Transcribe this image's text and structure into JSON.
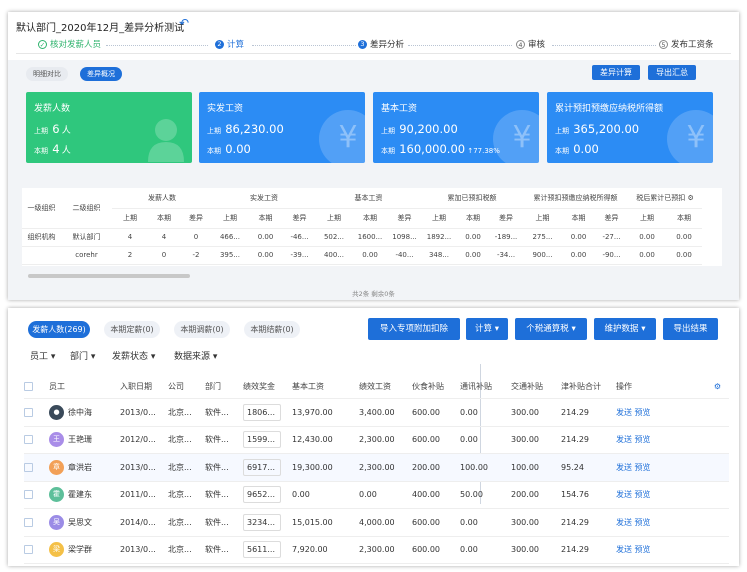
{
  "header": {
    "title": "默认部门_2020年12月_差异分析测试"
  },
  "steps": [
    {
      "label": "核对发薪人员",
      "index": "✓",
      "state": "done"
    },
    {
      "label": "计算",
      "index": "2",
      "state": "done"
    },
    {
      "label": "差异分析",
      "index": "3",
      "state": "active"
    },
    {
      "label": "审核",
      "index": "4",
      "state": "todo"
    },
    {
      "label": "发布工资条",
      "index": "5",
      "state": "todo"
    }
  ],
  "view_tabs": {
    "detail": "明细对比",
    "summary": "差异概况"
  },
  "buttons": {
    "diff_calc": "差异计算",
    "export_summary": "导出汇总"
  },
  "labels": {
    "prev": "上期",
    "curr": "本期"
  },
  "cards": [
    {
      "title": "发薪人数",
      "prev": "6",
      "prev_unit": "人",
      "curr": "4",
      "curr_unit": "人",
      "color": "#2fc77d",
      "icon": "person-icon"
    },
    {
      "title": "实发工资",
      "prev": "86,230.00",
      "curr": "0.00",
      "color": "#2c8cf4",
      "icon": "yen-icon"
    },
    {
      "title": "基本工资",
      "prev": "90,200.00",
      "curr": "160,000.00",
      "change": "↑77.38%",
      "color": "#2c8cf4",
      "icon": "yen-icon"
    },
    {
      "title": "累计预扣预缴应纳税所得额",
      "prev": "365,200.00",
      "curr": "0.00",
      "color": "#2c8cf4",
      "icon": "yen-icon"
    }
  ],
  "diff_table": {
    "col1": "一级组织",
    "col2": "二级组织",
    "groups": [
      "发薪人数",
      "实发工资",
      "基本工资",
      "累加已预扣税额",
      "累计预扣预缴应纳税所得额",
      "税后累计已预扣"
    ],
    "sub": [
      "上期",
      "本期",
      "差异"
    ],
    "rows": [
      {
        "org1": "组织机构",
        "org2": "默认部门",
        "cells": [
          "4",
          "4",
          "0",
          "466...",
          "0.00",
          "-46...",
          "502...",
          "1600...",
          "1098...",
          "1892...",
          "0.00",
          "-189...",
          "275...",
          "0.00",
          "-27...",
          "0.00",
          "0.00"
        ]
      },
      {
        "org1": "",
        "org2": "corehr",
        "cells": [
          "2",
          "0",
          "-2",
          "395...",
          "0.00",
          "-39...",
          "400...",
          "0.00",
          "-40...",
          "348...",
          "0.00",
          "-34...",
          "900...",
          "0.00",
          "-90...",
          "0.00",
          "0.00"
        ]
      }
    ],
    "footer": "共2条 剩余0条"
  },
  "payroll_tabs": [
    "发薪人数(269)",
    "本期定薪(0)",
    "本期调薪(0)",
    "本期结薪(0)"
  ],
  "actions": [
    "导入专项附加扣除",
    "计算 ▾",
    "个税通算税 ▾",
    "维护数据 ▾",
    "导出结果"
  ],
  "filters": [
    "员工 ▾",
    "部门 ▾",
    "发薪状态 ▾",
    "数据来源 ▾"
  ],
  "columns": [
    "员工",
    "入职日期",
    "公司",
    "部门",
    "绩效奖金",
    "基本工资",
    "绩效工资",
    "伙食补贴",
    "通讯补贴",
    "交通补贴",
    "津补贴合计",
    "操作"
  ],
  "row_actions": {
    "send": "发送",
    "preview": "预览"
  },
  "employees": [
    {
      "avatar": "",
      "color": "#3a4a5a",
      "name": "徐中海",
      "date": "2013/0...",
      "company": "北京...",
      "dept": "软件...",
      "bonus": "1806...",
      "base": "13,970.00",
      "perf": "3,400.00",
      "meal": "600.00",
      "comm": "0.00",
      "traffic": "300.00",
      "total": "214.29"
    },
    {
      "avatar": "王",
      "color": "#a98de8",
      "name": "王艳珊",
      "date": "2012/0...",
      "company": "北京...",
      "dept": "软件...",
      "bonus": "1599...",
      "base": "12,430.00",
      "perf": "2,300.00",
      "meal": "600.00",
      "comm": "0.00",
      "traffic": "300.00",
      "total": "214.29"
    },
    {
      "avatar": "章",
      "color": "#f2a057",
      "name": "章洪岩",
      "date": "2013/0...",
      "company": "北京...",
      "dept": "软件...",
      "bonus": "6917...",
      "base": "19,300.00",
      "perf": "2,300.00",
      "meal": "200.00",
      "comm": "100.00",
      "traffic": "100.00",
      "total": "95.24"
    },
    {
      "avatar": "霍",
      "color": "#5dbf9a",
      "name": "霍建东",
      "date": "2011/0...",
      "company": "北京...",
      "dept": "软件...",
      "bonus": "9652...",
      "base": "0.00",
      "perf": "0.00",
      "meal": "400.00",
      "comm": "50.00",
      "traffic": "200.00",
      "total": "154.76"
    },
    {
      "avatar": "吴",
      "color": "#9b8ce6",
      "name": "吴思文",
      "date": "2014/0...",
      "company": "北京...",
      "dept": "软件...",
      "bonus": "3234...",
      "base": "15,015.00",
      "perf": "4,000.00",
      "meal": "600.00",
      "comm": "0.00",
      "traffic": "300.00",
      "total": "214.29"
    },
    {
      "avatar": "梁",
      "color": "#f4c047",
      "name": "梁学群",
      "date": "2013/0...",
      "company": "北京...",
      "dept": "软件...",
      "bonus": "5611...",
      "base": "7,920.00",
      "perf": "2,300.00",
      "meal": "600.00",
      "comm": "0.00",
      "traffic": "300.00",
      "total": "214.29"
    }
  ]
}
